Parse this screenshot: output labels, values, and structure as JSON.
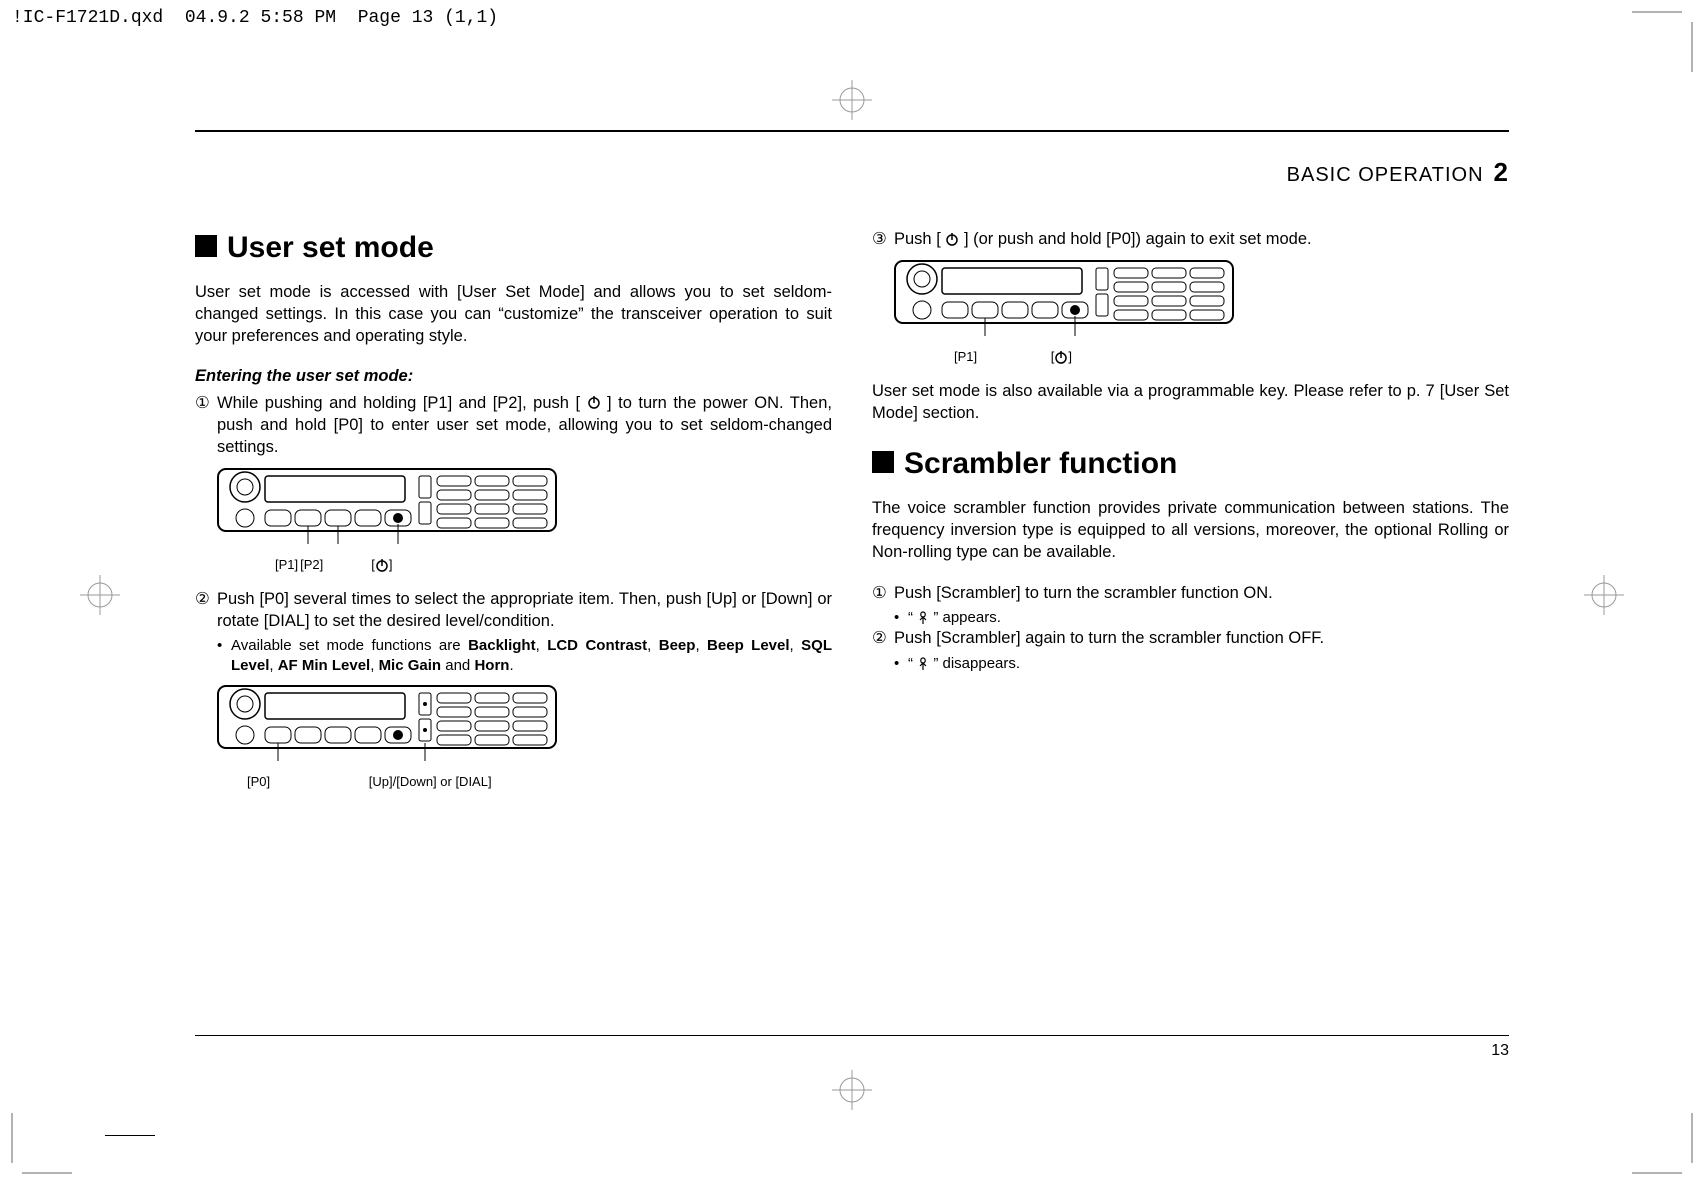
{
  "qxd": {
    "filename": "!IC-F1721D.qxd",
    "timestamp": "04.9.2 5:58 PM",
    "page_info": "Page 13 (1,1)"
  },
  "header": {
    "section_label": "BASIC OPERATION",
    "chapter_number": "2"
  },
  "left_column": {
    "heading": "User set mode",
    "intro": "User set mode is accessed with [User Set Mode] and allows you to set seldom-changed settings. In this case you can “customize” the transceiver operation to suit your preferences and operating style.",
    "subheading": "Entering the user set mode:",
    "step1_num": "①",
    "step1": "While pushing and holding [P1] and [P2], push [   ] to turn the power ON. Then, push and hold [P0] to enter user set mode, allowing you to set seldom-changed settings.",
    "diagram1_labels": {
      "p1": "[P1]",
      "p2": "[P2]",
      "power": "[  ]"
    },
    "step2_num": "②",
    "step2": "Push [P0] several times to select the appropriate item. Then, push [Up] or [Down] or rotate [DIAL] to set the desired level/condition.",
    "step2_bullet_prefix": "•",
    "step2_bullet_pre": "Available set mode functions are ",
    "step2_b1": "Backlight",
    "step2_c1": ", ",
    "step2_b2": "LCD Contrast",
    "step2_c2": ", ",
    "step2_b3": "Beep",
    "step2_c3": ", ",
    "step2_b4": "Beep Level",
    "step2_c4": ", ",
    "step2_b5": "SQL Level",
    "step2_c5": ", ",
    "step2_b6": "AF Min Level",
    "step2_c6": ", ",
    "step2_b7": "Mic Gain",
    "step2_c7": " and ",
    "step2_b8": "Horn",
    "step2_c8": ".",
    "diagram2_labels": {
      "p0": "[P0]",
      "up_down_dial": "[Up]/[Down] or [DIAL]"
    }
  },
  "right_column": {
    "step3_num": "③",
    "step3": "Push [   ] (or push and hold [P0]) again to exit set mode.",
    "diagram3_labels": {
      "p1": "[P1]",
      "power": "[  ]"
    },
    "programmable_note": "User set mode is also available via a programmable key. Please refer to p. 7 [User Set Mode] section.",
    "scrambler_heading": "Scrambler function",
    "scrambler_intro": "The voice scrambler function provides private communication between stations. The frequency inversion type is equipped to all versions, moreover, the optional Rolling or Non-rolling type can be available.",
    "scr_step1_num": "①",
    "scr_step1": "Push [Scrambler] to turn the scrambler function ON.",
    "scr_step1_bullet_prefix": "•",
    "scr_step1_bullet_a": "“ ",
    "scr_step1_bullet_b": " ” appears.",
    "scr_step2_num": "②",
    "scr_step2": "Push [Scrambler] again to turn the scrambler function OFF.",
    "scr_step2_bullet_prefix": "•",
    "scr_step2_bullet_a": "“ ",
    "scr_step2_bullet_b": " ” disappears."
  },
  "page_number": "13"
}
